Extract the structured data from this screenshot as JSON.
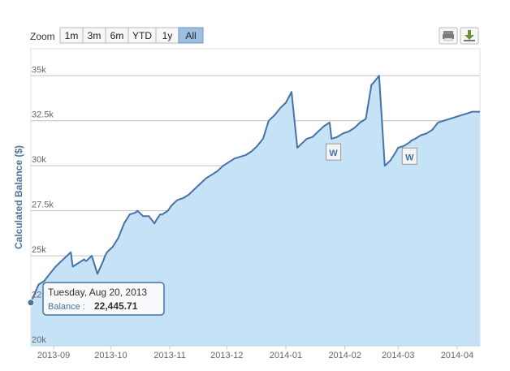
{
  "toolbar": {
    "zoom_label": "Zoom",
    "buttons": [
      {
        "label": "1m",
        "active": false
      },
      {
        "label": "3m",
        "active": false
      },
      {
        "label": "6m",
        "active": false
      },
      {
        "label": "YTD",
        "active": false
      },
      {
        "label": "1y",
        "active": false
      },
      {
        "label": "All",
        "active": true
      }
    ]
  },
  "export_icons": [
    "print-icon",
    "download-icon"
  ],
  "tooltip": {
    "date": "Tuesday, Aug 20, 2013",
    "series_label": "Balance :",
    "value": "22,445.71"
  },
  "colors": {
    "line": "#4572a7",
    "area": "#c6e2f7",
    "grid": "#c0c0c0",
    "axis_title": "#4d759e",
    "active_button": "#9bc0e3"
  },
  "chart_data": {
    "type": "area",
    "title": "",
    "xlabel": "",
    "ylabel": "Calculated Balance ($)",
    "ylim": [
      20000,
      36500
    ],
    "xlim": [
      "2013-08-20",
      "2014-04-13"
    ],
    "y_ticks": [
      20000,
      22500,
      25000,
      27500,
      30000,
      32500,
      35000
    ],
    "y_tick_labels": [
      "20k",
      "22.5k",
      "25k",
      "27.5k",
      "30k",
      "32.5k",
      "35k"
    ],
    "x_ticks": [
      "2013-09-01",
      "2013-10-01",
      "2013-11-01",
      "2013-12-01",
      "2014-01-01",
      "2014-02-01",
      "2014-03-01",
      "2014-04-01"
    ],
    "x_tick_labels": [
      "2013-09",
      "2013-10",
      "2013-11",
      "2013-12",
      "2014-01",
      "2014-02",
      "2014-03",
      "2014-04"
    ],
    "grid": true,
    "series": [
      {
        "x": [
          "2013-08-20",
          "2013-08-24",
          "2013-08-27",
          "2013-08-30",
          "2013-09-02",
          "2013-09-05",
          "2013-09-08",
          "2013-09-10",
          "2013-09-11",
          "2013-09-14",
          "2013-09-17",
          "2013-09-18",
          "2013-09-21",
          "2013-09-24",
          "2013-09-27",
          "2013-09-28",
          "2013-09-29",
          "2013-10-02",
          "2013-10-05",
          "2013-10-08",
          "2013-10-11",
          "2013-10-14",
          "2013-10-15",
          "2013-10-18",
          "2013-10-21",
          "2013-10-24",
          "2013-10-25",
          "2013-10-27",
          "2013-10-28",
          "2013-10-31",
          "2013-11-02",
          "2013-11-05",
          "2013-11-08",
          "2013-11-11",
          "2013-11-14",
          "2013-11-17",
          "2013-11-20",
          "2013-11-23",
          "2013-11-26",
          "2013-11-29",
          "2013-12-02",
          "2013-12-05",
          "2013-12-08",
          "2013-12-11",
          "2013-12-14",
          "2013-12-17",
          "2013-12-20",
          "2013-12-23",
          "2013-12-26",
          "2013-12-29",
          "2014-01-01",
          "2014-01-04",
          "2014-01-07",
          "2014-01-10",
          "2014-01-12",
          "2014-01-15",
          "2014-01-18",
          "2014-01-21",
          "2014-01-24",
          "2014-01-25",
          "2014-01-28",
          "2014-01-31",
          "2014-02-03",
          "2014-02-06",
          "2014-02-09",
          "2014-02-12",
          "2014-02-15",
          "2014-02-16",
          "2014-02-19",
          "2014-02-22",
          "2014-02-25",
          "2014-02-28",
          "2014-03-01",
          "2014-03-04",
          "2014-03-07",
          "2014-03-08",
          "2014-03-10",
          "2014-03-13",
          "2014-03-16",
          "2014-03-19",
          "2014-03-22",
          "2014-03-25",
          "2014-03-28",
          "2014-03-31",
          "2014-04-03",
          "2014-04-06",
          "2014-04-09",
          "2014-04-13"
        ],
        "y": [
          22400,
          23400,
          23600,
          24000,
          24400,
          24700,
          25000,
          25200,
          24400,
          24600,
          24800,
          24700,
          25000,
          24000,
          24700,
          25000,
          25200,
          25500,
          26000,
          26800,
          27300,
          27400,
          27500,
          27200,
          27200,
          26800,
          27000,
          27300,
          27300,
          27500,
          27800,
          28100,
          28200,
          28400,
          28700,
          29000,
          29300,
          29500,
          29700,
          30000,
          30200,
          30400,
          30500,
          30600,
          30800,
          31100,
          31500,
          32500,
          32800,
          33200,
          33500,
          34100,
          31000,
          31300,
          31500,
          31600,
          31900,
          32200,
          32400,
          31500,
          31600,
          31800,
          31900,
          32100,
          32400,
          32600,
          34500,
          34600,
          35000,
          30000,
          30300,
          30800,
          31000,
          31100,
          31300,
          31400,
          31500,
          31700,
          31800,
          32000,
          32400,
          32500,
          32600,
          32700,
          32800,
          32900,
          33000,
          33000
        ]
      }
    ],
    "flags": [
      {
        "date": "2014-01-26",
        "text": "W"
      },
      {
        "date": "2014-03-07",
        "text": "W"
      }
    ]
  }
}
